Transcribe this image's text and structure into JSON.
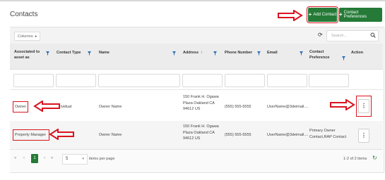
{
  "page": {
    "title": "Contacts"
  },
  "actions": {
    "add_contact": "Add Contact",
    "contact_preferences": "Contact Preferences",
    "plus": "+"
  },
  "toolbar": {
    "columns_label": "Columns",
    "columns_caret": "▸",
    "refresh_glyph": "⟳",
    "search_placeholder": "Search..."
  },
  "table": {
    "headers": {
      "associated": "Associated to asset as",
      "contact_type": "Contact Type",
      "name": "Name",
      "address": "Address",
      "sort_glyph": "↑",
      "phone": "Phone Number",
      "email": "Email",
      "preference": "Contact Preference",
      "action": "Action"
    },
    "rows": [
      {
        "associated": "Owner",
        "contact_type": "ividual",
        "name": "Owner Name",
        "address": "150 Frank H. Ogawa Plaza Oakland CA 94612 US",
        "phone": "(555) 555-5555",
        "email": "UserName@3deimail....",
        "preference": "",
        "action": "⋮"
      },
      {
        "associated": "Property Manager",
        "contact_type": "",
        "name": "Owner Name",
        "address": "150 Frank H. Ogawa Plaza Oakland CA 94612 US",
        "phone": "(555) 555-5555",
        "email": "UserName@3deimail....",
        "preference": "Primary Owner Contact,RAP Contact",
        "action": "⋮"
      }
    ]
  },
  "pagination": {
    "first": "«",
    "prev": "‹",
    "current_page": "1",
    "next": "›",
    "last": "»",
    "page_size": "5",
    "page_size_caret": "▾",
    "items_per_page": "items per page",
    "count_text": "1-2 of 2 items",
    "reload_glyph": "↻"
  },
  "colors": {
    "accent": "#247a36",
    "annotation": "#d9141e"
  }
}
